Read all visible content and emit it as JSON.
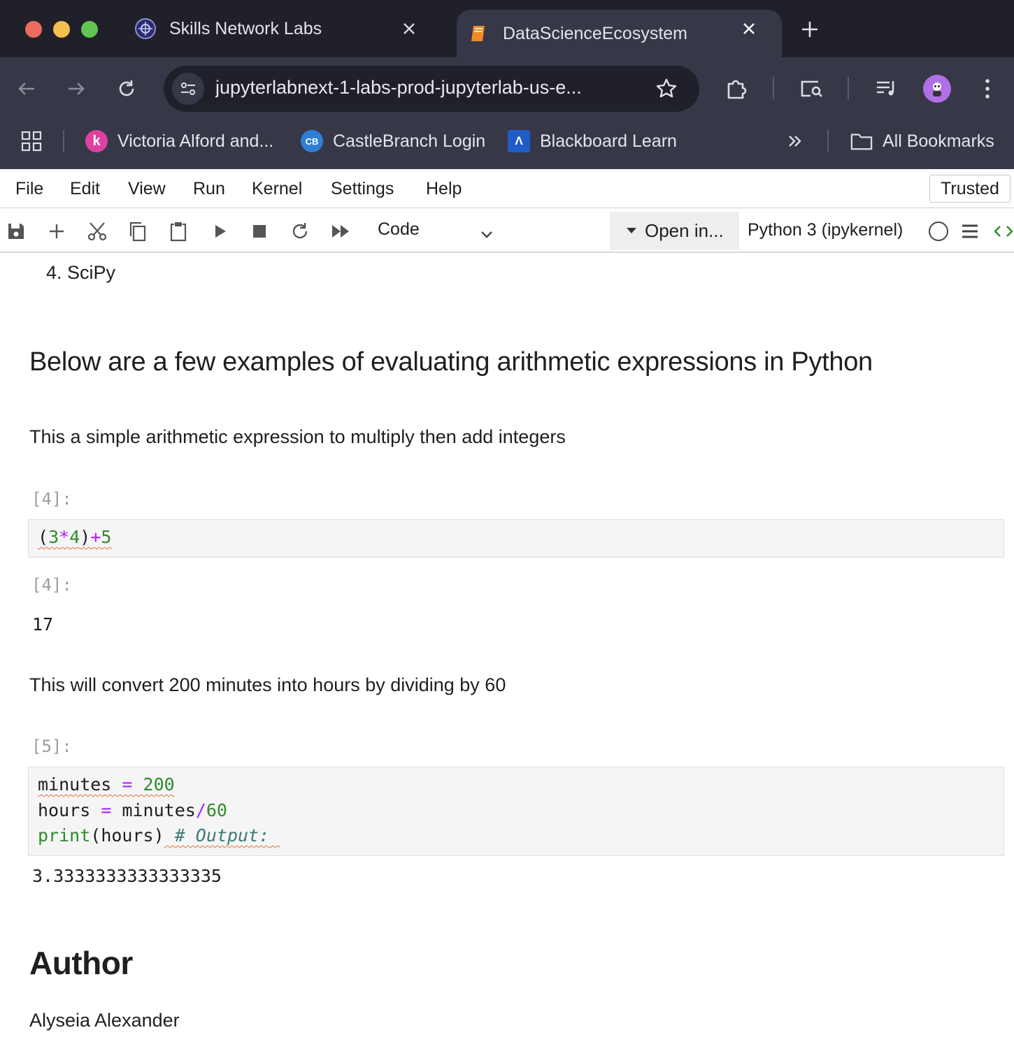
{
  "browser": {
    "tabs": [
      {
        "title": "Skills Network Labs",
        "icon": "skills-network-icon"
      },
      {
        "title": "DataScienceEcosystem",
        "icon": "notebook-book-icon",
        "active": true
      }
    ],
    "url": "jupyterlabnext-1-labs-prod-jupyterlab-us-e...",
    "bookmarks": [
      {
        "label": "Victoria Alford and...",
        "icon": "k-logo-icon",
        "color": "#e040a0"
      },
      {
        "label": "CastleBranch Login",
        "icon": "cb-logo-icon",
        "color": "#2f7fd6"
      },
      {
        "label": "Blackboard Learn",
        "icon": "blackboard-icon",
        "color": "#1f5cc7"
      }
    ],
    "all_bookmarks_label": "All Bookmarks"
  },
  "menu": {
    "items": [
      "File",
      "Edit",
      "View",
      "Run",
      "Kernel",
      "Settings",
      "Help"
    ],
    "trusted": "Trusted"
  },
  "toolbar": {
    "cell_type": "Code",
    "open_in": "Open in...",
    "kernel": "Python 3 (ipykernel)"
  },
  "notebook": {
    "list_item": "4. SciPy",
    "heading": "Below are a few examples of evaluating arithmetic expressions in Python",
    "para1": "This a simple arithmetic expression to multiply then add integers",
    "cell1": {
      "in_prompt": "[4]:",
      "code": {
        "open": "(",
        "a": "3",
        "mul": "*",
        "b": "4",
        "close": ")",
        "plus": "+",
        "c": "5"
      },
      "out_prompt": "[4]:",
      "output": "17"
    },
    "para2": "This will convert 200 minutes into hours by dividing by 60",
    "cell2": {
      "in_prompt": "[5]:",
      "line1": {
        "var": "minutes",
        "eq": "=",
        "val": "200"
      },
      "line2": {
        "var": "hours",
        "eq": "=",
        "ref": "minutes",
        "div": "/",
        "val": "60"
      },
      "line3": {
        "fn": "print",
        "args": "(hours)",
        "comment": "# Output:"
      },
      "output": "3.3333333333333335"
    },
    "author_heading": "Author",
    "author_name": "Alyseia Alexander"
  },
  "colors": {
    "chrome_dark": "#1f2029",
    "chrome_mid": "#363848",
    "code_bg": "#f5f5f5",
    "number_green": "#2f8a2a",
    "operator_purple": "#aa22ff"
  }
}
